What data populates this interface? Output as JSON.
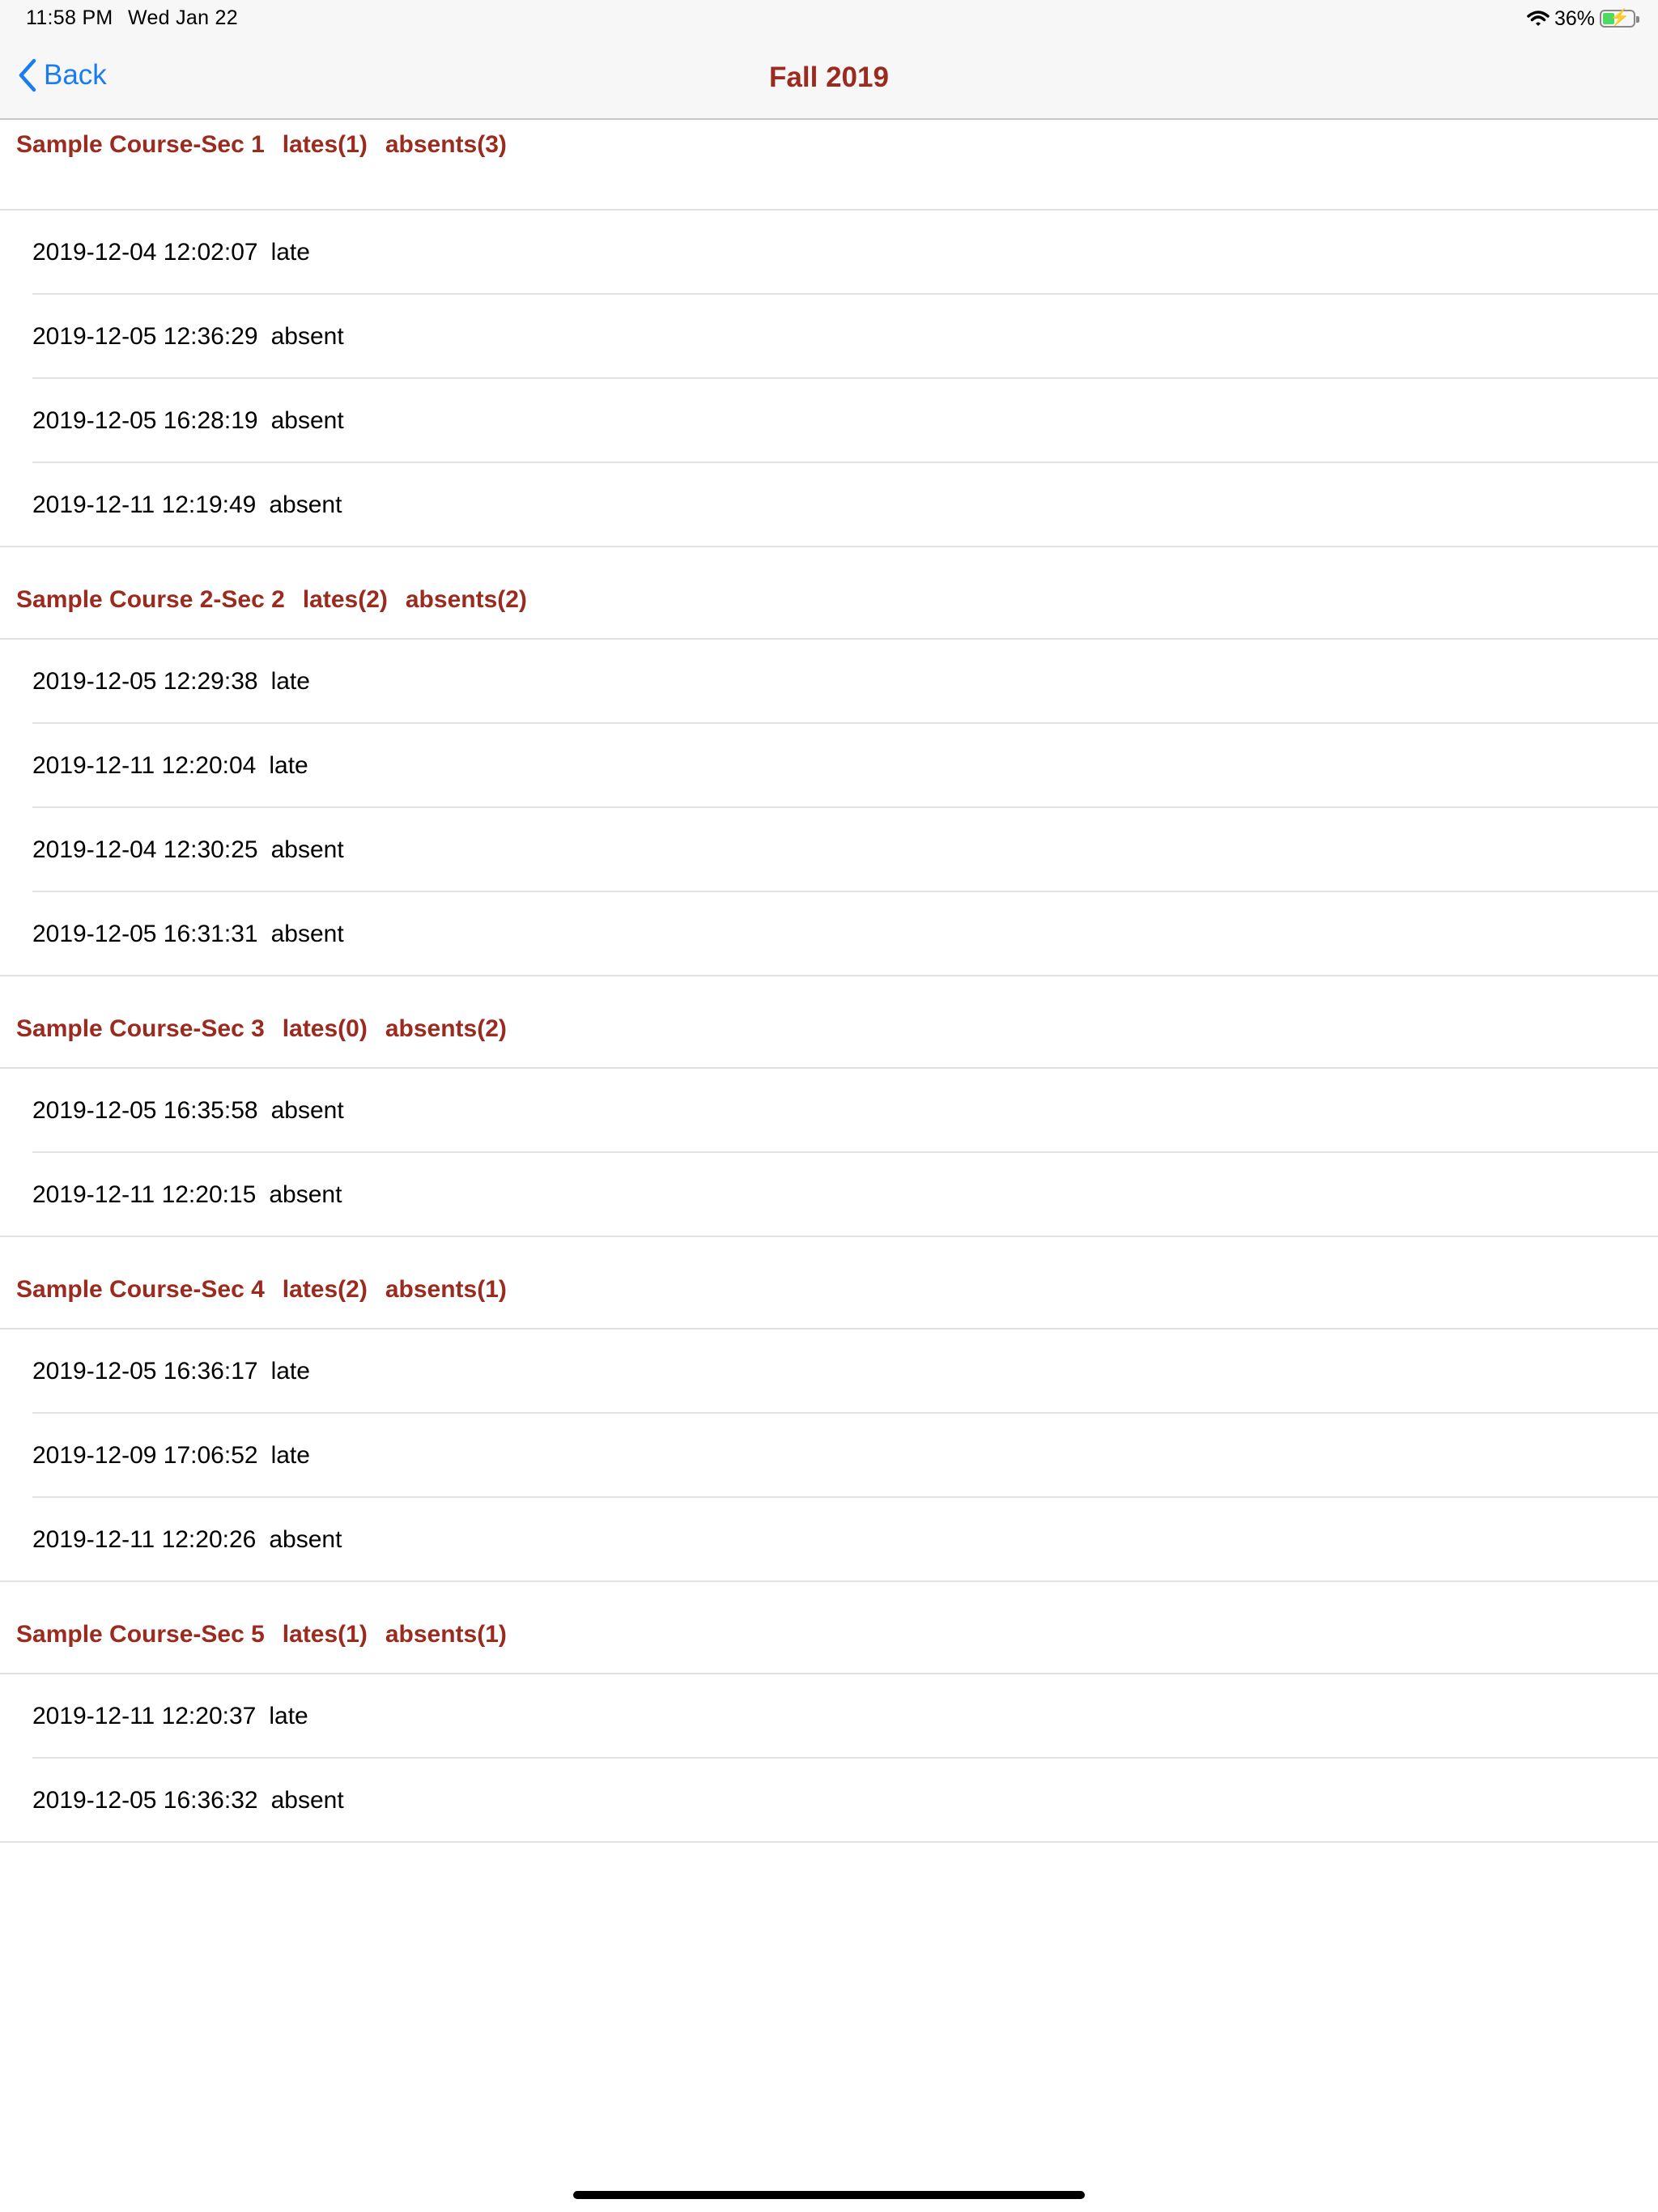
{
  "status_bar": {
    "time": "11:58 PM",
    "date": "Wed Jan 22",
    "battery": "36%"
  },
  "nav": {
    "back_label": "Back",
    "title": "Fall 2019"
  },
  "sections": [
    {
      "course": "Sample Course-Sec 1",
      "lates": "lates(1)",
      "absents": "absents(3)",
      "records": [
        {
          "time": "2019-12-04 12:02:07",
          "status": "late"
        },
        {
          "time": "2019-12-05 12:36:29",
          "status": "absent"
        },
        {
          "time": "2019-12-05 16:28:19",
          "status": "absent"
        },
        {
          "time": "2019-12-11 12:19:49",
          "status": "absent"
        }
      ]
    },
    {
      "course": "Sample Course 2-Sec 2",
      "lates": "lates(2)",
      "absents": "absents(2)",
      "records": [
        {
          "time": "2019-12-05 12:29:38",
          "status": "late"
        },
        {
          "time": "2019-12-11 12:20:04",
          "status": "late"
        },
        {
          "time": "2019-12-04 12:30:25",
          "status": "absent"
        },
        {
          "time": "2019-12-05 16:31:31",
          "status": "absent"
        }
      ]
    },
    {
      "course": "Sample Course-Sec 3",
      "lates": "lates(0)",
      "absents": "absents(2)",
      "records": [
        {
          "time": "2019-12-05 16:35:58",
          "status": "absent"
        },
        {
          "time": "2019-12-11 12:20:15",
          "status": "absent"
        }
      ]
    },
    {
      "course": "Sample Course-Sec 4",
      "lates": "lates(2)",
      "absents": "absents(1)",
      "records": [
        {
          "time": "2019-12-05 16:36:17",
          "status": "late"
        },
        {
          "time": "2019-12-09 17:06:52",
          "status": "late"
        },
        {
          "time": "2019-12-11 12:20:26",
          "status": "absent"
        }
      ]
    },
    {
      "course": "Sample Course-Sec 5",
      "lates": "lates(1)",
      "absents": "absents(1)",
      "records": [
        {
          "time": "2019-12-11 12:20:37",
          "status": "late"
        },
        {
          "time": "2019-12-05 16:36:32",
          "status": "absent"
        }
      ]
    }
  ]
}
